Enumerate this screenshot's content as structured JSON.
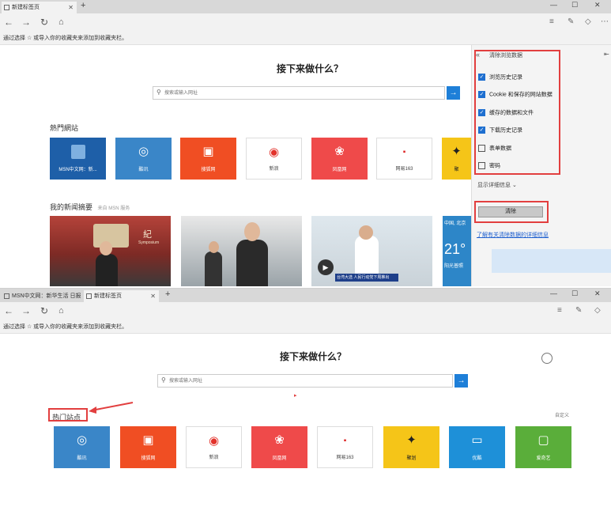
{
  "top_window": {
    "tabs": [
      {
        "label": "新建标签页",
        "active": true
      }
    ],
    "favorites_hint": "通过选择 ☆ 或导入你的收藏夹来添加到收藏夹栏。",
    "heading": "接下来做什么？",
    "search_placeholder": "搜索或输入网址",
    "popular_title": "熱門網站",
    "tiles": [
      {
        "label": "MSN中文网：新...",
        "icon": "msn",
        "color": "#1e5fa8"
      },
      {
        "label": "酷讯",
        "icon": "kuxun",
        "color": "#3a86c8"
      },
      {
        "label": "搜狐网",
        "icon": "sohu",
        "color": "#f04e23"
      },
      {
        "label": "新浪",
        "icon": "weibo",
        "color": "#ffffff"
      },
      {
        "label": "凤凰网",
        "icon": "ifeng",
        "color": "#ef4a4a"
      },
      {
        "label": "网易163",
        "icon": "netease",
        "color": "#ffffff"
      },
      {
        "label": "聚",
        "icon": "star",
        "color": "#f5c518"
      }
    ],
    "news_title": "我的新闻摘要",
    "news_source": "来自 MSN 服务",
    "news_cards": [
      {
        "caption": "紀",
        "sub": "Symposium"
      },
      {
        "caption": ""
      },
      {
        "caption": "台湾大选 人民行动党下周推出"
      },
      {
        "caption": "中国, 北京",
        "temp": "21°",
        "sub": "阳光普照"
      }
    ],
    "clear_panel": {
      "title": "清除浏览数据",
      "back_icon": "«",
      "pin_icon": "pin",
      "options": [
        {
          "label": "浏览历史记录",
          "checked": true
        },
        {
          "label": "Cookie 和保存的网站数据",
          "checked": true
        },
        {
          "label": "缓存的数据和文件",
          "checked": true
        },
        {
          "label": "下载历史记录",
          "checked": true
        },
        {
          "label": "表单数据",
          "checked": false
        },
        {
          "label": "密码",
          "checked": false
        }
      ],
      "show_more": "显示详细信息 ⌄",
      "clear_button": "清除",
      "learn_more": "了解有关清除数据的详细信息"
    }
  },
  "bottom_window": {
    "tabs": [
      {
        "label": "MSN中文网：新华生活 日报",
        "active": false
      },
      {
        "label": "新建标签页",
        "active": true
      }
    ],
    "favorites_hint": "通过选择 ☆ 或导入你的收藏夹来添加到收藏夹栏。",
    "heading": "接下来做什么？",
    "search_placeholder": "搜索或输入网址",
    "popular_title": "热门站点",
    "customize": "自定义",
    "tiles": [
      {
        "label": "酷讯",
        "icon": "kuxun",
        "color": "#3a86c8"
      },
      {
        "label": "搜狐网",
        "icon": "sohu",
        "color": "#f04e23"
      },
      {
        "label": "新浪",
        "icon": "weibo",
        "color": "#ffffff"
      },
      {
        "label": "凤凰网",
        "icon": "ifeng",
        "color": "#ef4a4a"
      },
      {
        "label": "网易163",
        "icon": "netease",
        "color": "#ffffff"
      },
      {
        "label": "聚划",
        "icon": "star",
        "color": "#f5c518"
      },
      {
        "label": "优酷",
        "icon": "youku",
        "color": "#1e90d8"
      },
      {
        "label": "爱奇艺",
        "icon": "iqiyi",
        "color": "#5aae3a"
      }
    ]
  },
  "colors": {
    "accent": "#1e7fd8",
    "highlight": "#e23f3f"
  }
}
